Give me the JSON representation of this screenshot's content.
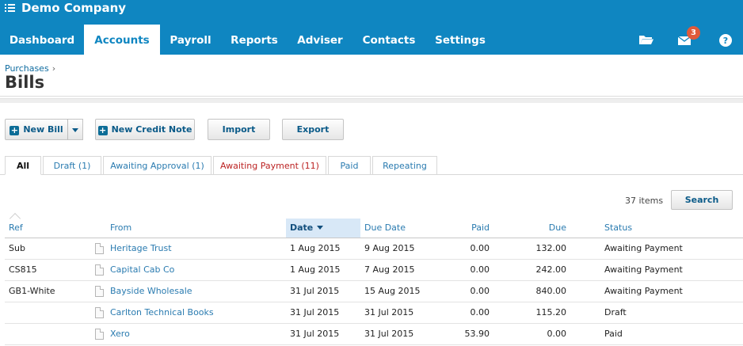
{
  "header": {
    "org_name": "Demo Company",
    "menu_icon": "list-menu-icon"
  },
  "nav": {
    "items": [
      {
        "label": "Dashboard"
      },
      {
        "label": "Accounts"
      },
      {
        "label": "Payroll"
      },
      {
        "label": "Reports"
      },
      {
        "label": "Adviser"
      },
      {
        "label": "Contacts"
      },
      {
        "label": "Settings"
      }
    ],
    "active": "Accounts",
    "icons": [
      "folder-icon",
      "mail-icon",
      "help-icon"
    ],
    "mail_badge": "3"
  },
  "breadcrumb": {
    "parent": "Purchases",
    "separator": "›"
  },
  "page": {
    "title": "Bills"
  },
  "toolbar": {
    "new_bill": "New Bill",
    "new_credit_note": "New Credit Note",
    "import": "Import",
    "export": "Export"
  },
  "tabs": [
    {
      "label": "All"
    },
    {
      "label": "Draft (1)"
    },
    {
      "label": "Awaiting Approval (1)"
    },
    {
      "label": "Awaiting Payment (11)"
    },
    {
      "label": "Paid"
    },
    {
      "label": "Repeating"
    }
  ],
  "list": {
    "items_count": "37 items",
    "search_label": "Search",
    "columns": {
      "ref": "Ref",
      "from": "From",
      "date": "Date",
      "due_date": "Due Date",
      "paid": "Paid",
      "due": "Due",
      "status": "Status"
    },
    "rows": [
      {
        "ref": "Sub",
        "from": "Heritage Trust",
        "date": "1 Aug 2015",
        "due_date": "9 Aug 2015",
        "paid": "0.00",
        "due": "132.00",
        "status": "Awaiting Payment"
      },
      {
        "ref": "CS815",
        "from": "Capital Cab Co",
        "date": "1 Aug 2015",
        "due_date": "7 Aug 2015",
        "paid": "0.00",
        "due": "242.00",
        "status": "Awaiting Payment"
      },
      {
        "ref": "GB1-White",
        "from": "Bayside Wholesale",
        "date": "31 Jul 2015",
        "due_date": "15 Aug 2015",
        "paid": "0.00",
        "due": "840.00",
        "status": "Awaiting Payment"
      },
      {
        "ref": "",
        "from": "Carlton Technical Books",
        "date": "31 Jul 2015",
        "due_date": "31 Jul 2015",
        "paid": "0.00",
        "due": "115.20",
        "status": "Draft"
      },
      {
        "ref": "",
        "from": "Xero",
        "date": "31 Jul 2015",
        "due_date": "31 Jul 2015",
        "paid": "53.90",
        "due": "0.00",
        "status": "Paid"
      }
    ]
  },
  "colors": {
    "brand": "#0f86c1",
    "alert": "#b22222",
    "badge": "#e05a3a"
  }
}
